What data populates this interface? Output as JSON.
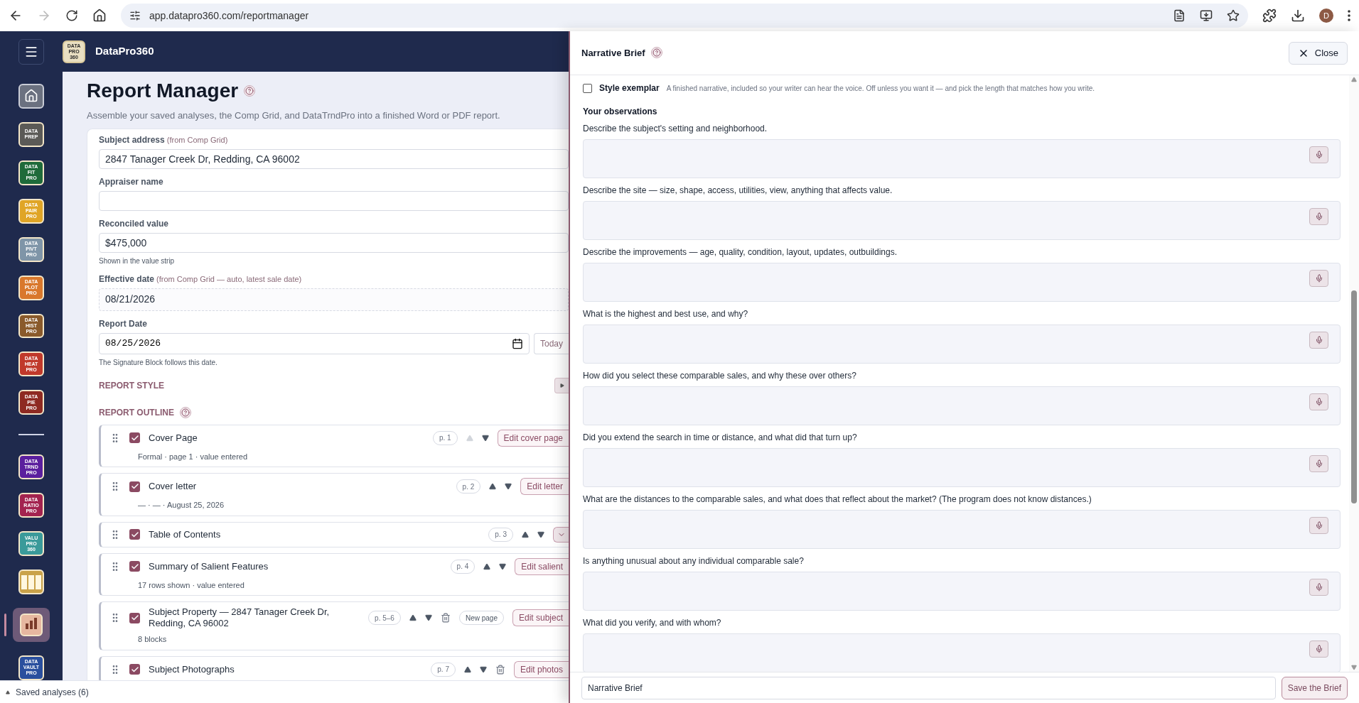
{
  "browser": {
    "url": "app.datapro360.com/reportmanager",
    "avatar": "D"
  },
  "app": {
    "brand": "DataPro360",
    "logo_lines": [
      "DATA",
      "PRO",
      "360"
    ]
  },
  "sidebar": {
    "items": [
      {
        "kind": "home",
        "selected": false
      },
      {
        "kind": "tile",
        "lines": [
          "DATA",
          "PREP"
        ],
        "color": "#5b5a57",
        "selected": false
      },
      {
        "kind": "tile",
        "lines": [
          "DATA",
          "FIT",
          "PRO"
        ],
        "color": "#1f6b3a",
        "selected": false
      },
      {
        "kind": "tile",
        "lines": [
          "DATA",
          "PAIR",
          "PRO"
        ],
        "color": "#e0a526",
        "selected": false
      },
      {
        "kind": "tile",
        "lines": [
          "DATA",
          "PIVT",
          "PRO"
        ],
        "color": "#7f95a8",
        "selected": false
      },
      {
        "kind": "tile",
        "lines": [
          "DATA",
          "PLOT",
          "PRO"
        ],
        "color": "#d9782c",
        "selected": false
      },
      {
        "kind": "tile",
        "lines": [
          "DATA",
          "HIST",
          "PRO"
        ],
        "color": "#8a5a2b",
        "selected": false
      },
      {
        "kind": "tile",
        "lines": [
          "DATA",
          "HEAT",
          "PRO"
        ],
        "color": "#c0392b",
        "selected": false
      },
      {
        "kind": "tile",
        "lines": [
          "DATA",
          "PIE",
          "PRO"
        ],
        "color": "#8e2a22",
        "selected": false
      },
      {
        "kind": "divider"
      },
      {
        "kind": "tile",
        "lines": [
          "DATA",
          "TRND",
          "PRO"
        ],
        "color": "#5b1f9e",
        "selected": false
      },
      {
        "kind": "tile",
        "lines": [
          "DATA",
          "RATIO",
          "PRO"
        ],
        "color": "#a3234f",
        "selected": false
      },
      {
        "kind": "tile",
        "lines": [
          "VALU",
          "PRO",
          "360"
        ],
        "color": "#3a9a9a",
        "selected": false
      },
      {
        "kind": "table",
        "color": "#c9a24a",
        "selected": false
      },
      {
        "kind": "report",
        "color": "#e6b7a0",
        "selected": true
      },
      {
        "kind": "tile",
        "lines": [
          "DATA",
          "VAULT",
          "PRO"
        ],
        "color": "#2a4f9e",
        "selected": false
      }
    ]
  },
  "main": {
    "title": "Report Manager",
    "subtitle": "Assemble your saved analyses, the Comp Grid, and DataTrndPro into a finished Word or PDF report.",
    "fields": [
      {
        "kind": "text",
        "label": "Subject address",
        "hint": "(from Comp Grid)",
        "value": "2847 Tanager Creek Dr, Redding, CA 96002"
      },
      {
        "kind": "text",
        "label": "Appraiser name"
      },
      {
        "kind": "text",
        "label": "Reconciled value",
        "value": "$475,000",
        "note": "Shown in the value strip"
      },
      {
        "kind": "readonly",
        "label": "Effective date",
        "hint": "(from Comp Grid — auto, latest sale date)",
        "value": "08/21/2026"
      },
      {
        "kind": "date",
        "label": "Report Date",
        "value": "08/25/2026",
        "button": "Today",
        "note": "The Signature Block follows this date."
      }
    ],
    "report_style": {
      "label": "REPORT STYLE"
    },
    "outline": {
      "label": "REPORT OUTLINE",
      "rows": [
        {
          "title": "Cover Page",
          "subtitle": "Formal · page 1 · value entered",
          "page": "p. 1",
          "checked": true,
          "up_disabled": true,
          "delete": false,
          "edit": "Edit cover page"
        },
        {
          "title": "Cover letter",
          "subtitle": "— · — · August 25, 2026",
          "page": "p. 2",
          "checked": true,
          "up_disabled": false,
          "delete": false,
          "edit": "Edit letter"
        },
        {
          "title": "Table of Contents",
          "page": "p. 3",
          "checked": true,
          "up_disabled": false,
          "delete": false
        },
        {
          "title": "Summary of Salient Features",
          "subtitle": "17 rows shown · value entered",
          "page": "p. 4",
          "checked": true,
          "up_disabled": false,
          "delete": false,
          "edit": "Edit salient"
        },
        {
          "title": "Subject Property — 2847 Tanager Creek Dr, Redding, CA 96002",
          "subtitle": "8 blocks",
          "page": "p. 5–6",
          "checked": true,
          "up_disabled": false,
          "delete": true,
          "new_page": "New page",
          "edit": "Edit subject"
        },
        {
          "title": "Subject Photographs",
          "page": "p. 7",
          "checked": true,
          "up_disabled": false,
          "delete": true,
          "edit": "Edit photos"
        }
      ]
    }
  },
  "saved_bar": {
    "label": "Saved analyses (6)"
  },
  "panel": {
    "title": "Narrative Brief",
    "close": "Close",
    "exemplar": {
      "checked": false,
      "label": "Style exemplar",
      "description": "A finished narrative, included so your writer can hear the voice. Off unless you want it — and pick the length that matches how you write."
    },
    "section_title": "Your observations",
    "questions": [
      "Describe the subject's setting and neighborhood.",
      "Describe the site — size, shape, access, utilities, view, anything that affects value.",
      "Describe the improvements — age, quality, condition, layout, updates, outbuildings.",
      "What is the highest and best use, and why?",
      "How did you select these comparable sales, and why these over others?",
      "Did you extend the search in time or distance, and what did that turn up?",
      "What are the distances to the comparable sales, and what does that reflect about the market? (The program does not know distances.)",
      "Is anything unusual about any individual comparable sale?",
      "What did you verify, and with whom?"
    ],
    "footer": {
      "value": "Narrative Brief",
      "save": "Save the Brief"
    }
  }
}
